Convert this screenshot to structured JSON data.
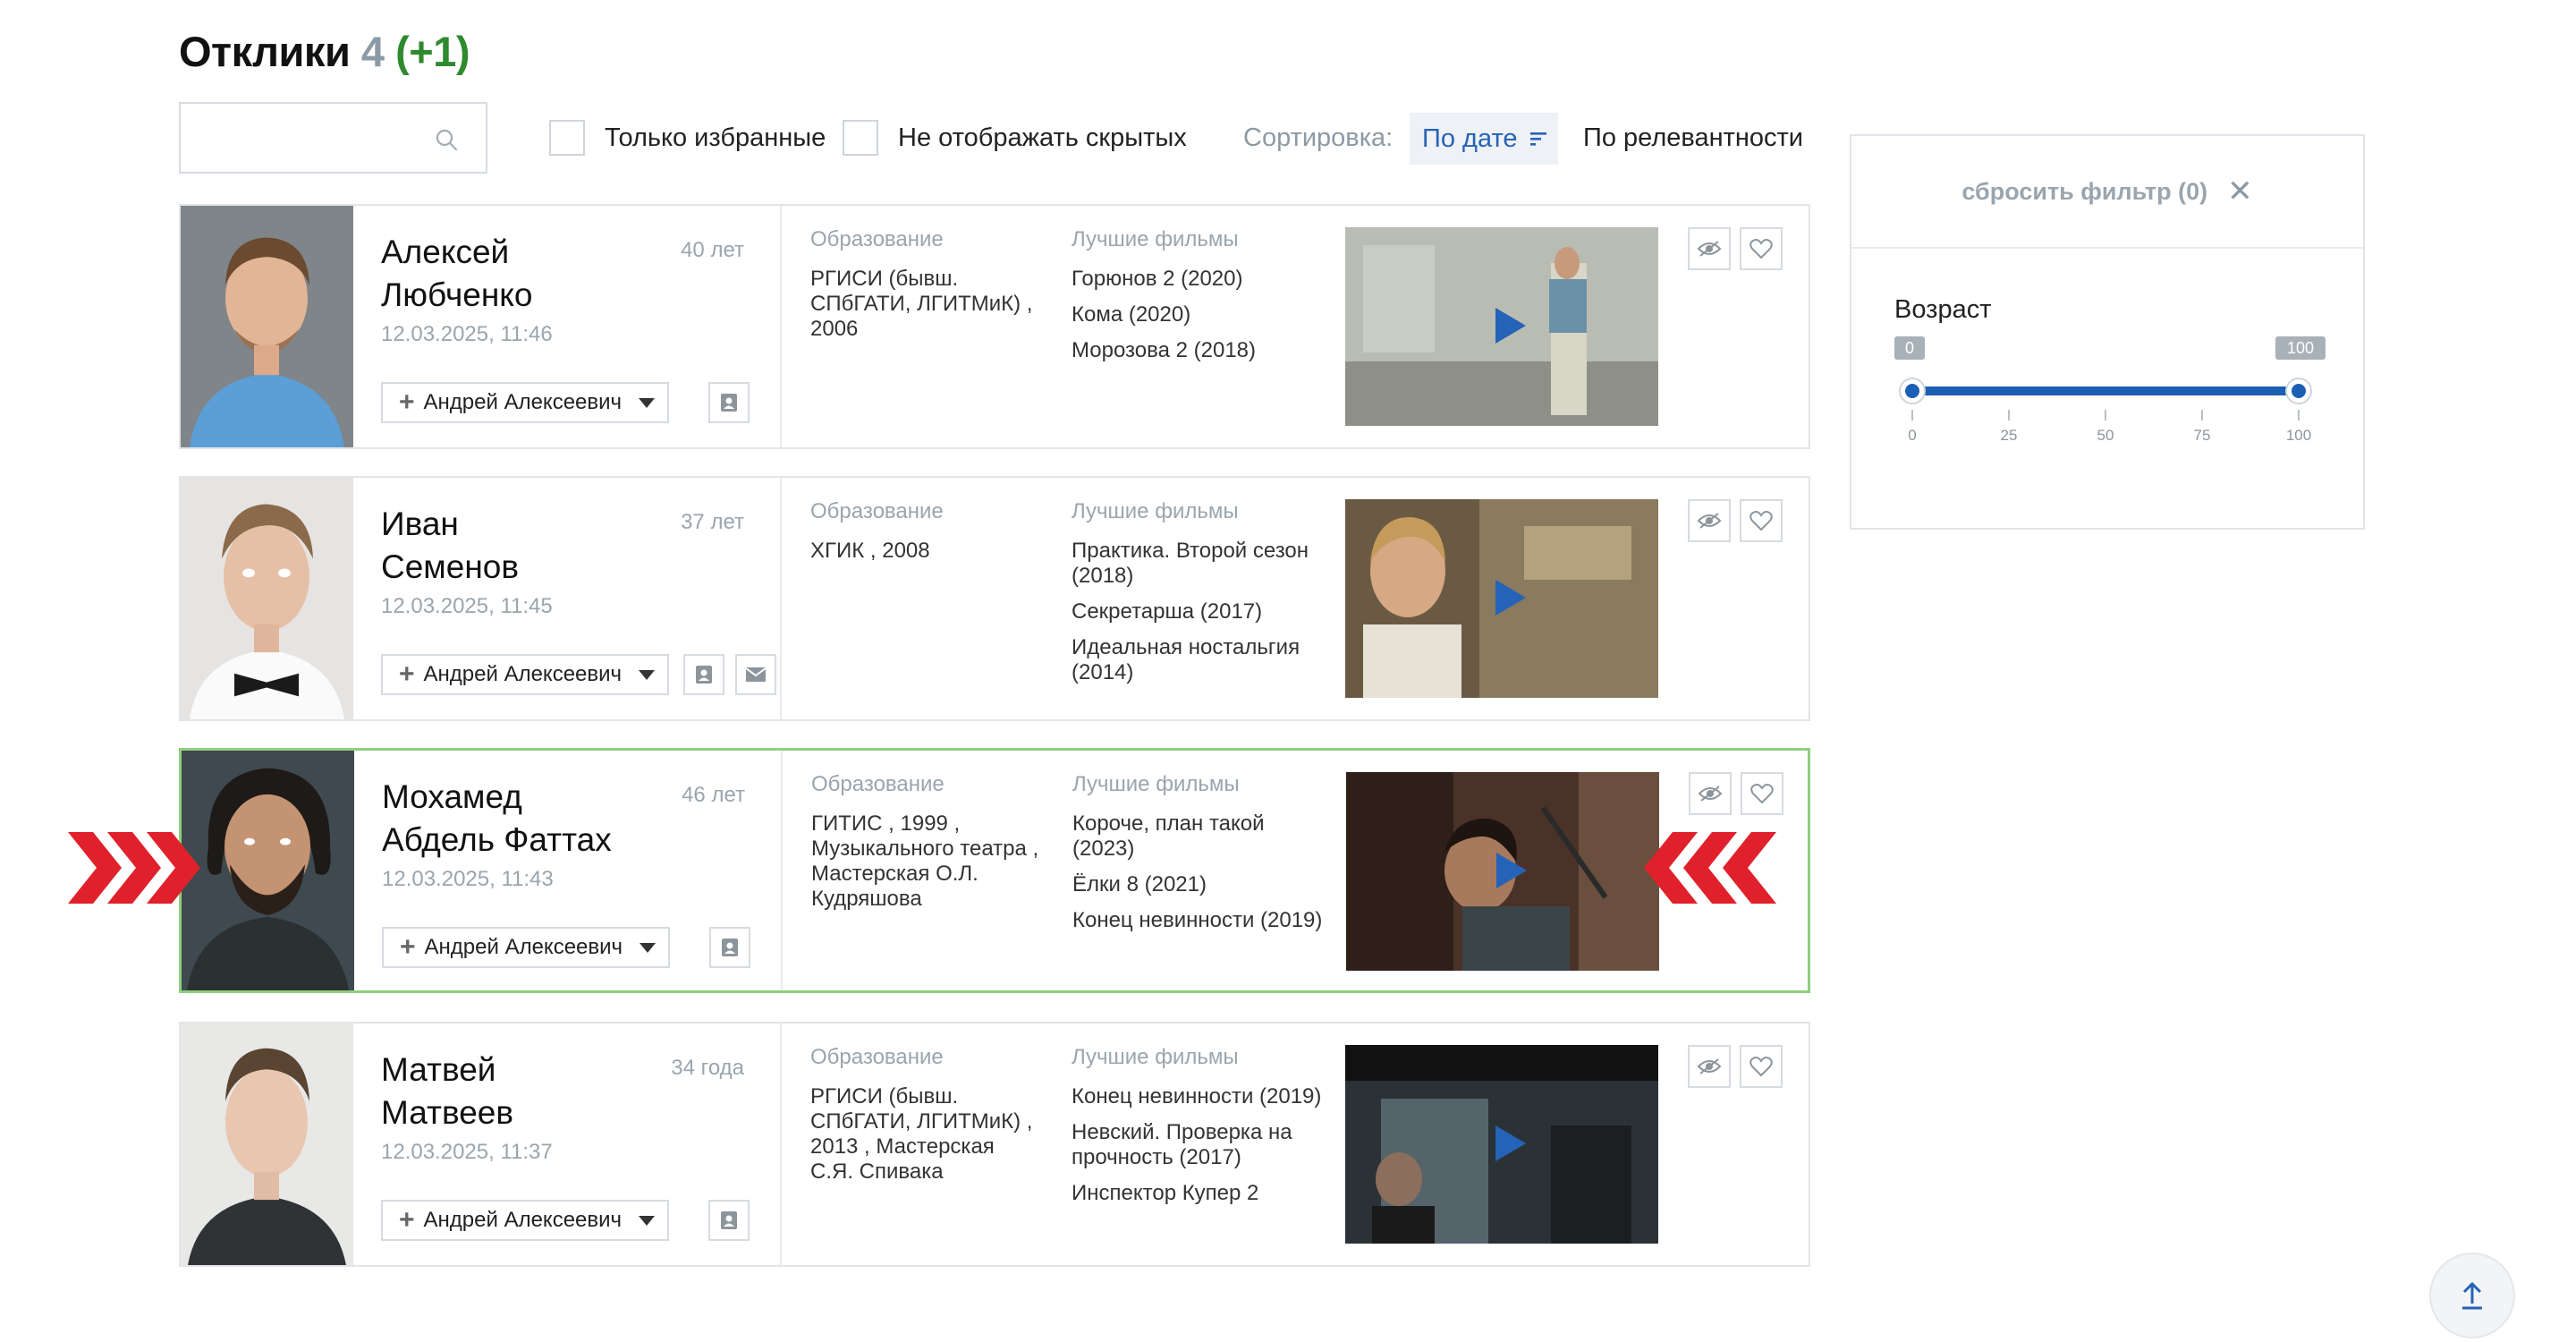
{
  "header": {
    "title": "Отклики",
    "count": "4",
    "new_count": "(+1)"
  },
  "search": {
    "placeholder": "",
    "value": ""
  },
  "filters": {
    "only_favorites": "Только избранные",
    "hide_hidden": "Не отображать скрытых",
    "sort_label": "Сортировка:",
    "sort_by_date": "По дате",
    "sort_by_relevance": "По релевантности"
  },
  "labels": {
    "education": "Образование",
    "best_films": "Лучшие фильмы"
  },
  "candidates": [
    {
      "name_first": "Алексей",
      "name_last": "Любченко",
      "age": "40 лет",
      "date": "12.03.2025, 11:46",
      "assignee": "Андрей Алексеевич",
      "education": "РГИСИ (бывш. СПбГАТИ, ЛГИТМиК) , 2006",
      "films": [
        "Горюнов 2 (2020)",
        "Кома (2020)",
        "Морозова 2 (2018)"
      ]
    },
    {
      "name_first": "Иван",
      "name_last": "Семенов",
      "age": "37 лет",
      "date": "12.03.2025, 11:45",
      "assignee": "Андрей Алексеевич",
      "education": "ХГИК , 2008",
      "films": [
        "Практика. Второй сезон (2018)",
        "Секретарша (2017)",
        "Идеальная ностальгия (2014)"
      ]
    },
    {
      "name_first": "Мохамед",
      "name_last": "Абдель Фаттах",
      "age": "46 лет",
      "date": "12.03.2025, 11:43",
      "assignee": "Андрей Алексеевич",
      "education": "ГИТИС , 1999 , Музыкального театра , Мастерская О.Л. Кудряшова",
      "films": [
        "Короче, план такой (2023)",
        "Ёлки 8 (2021)",
        "Конец невинности (2019)"
      ]
    },
    {
      "name_first": "Матвей",
      "name_last": "Матвеев",
      "age": "34 года",
      "date": "12.03.2025, 11:37",
      "assignee": "Андрей Алексеевич",
      "education": "РГИСИ (бывш. СПбГАТИ, ЛГИТМиК) , 2013 , Мастерская С.Я. Спивака",
      "films": [
        "Конец невинности (2019)",
        "Невский. Проверка на прочность (2017)",
        "Инспектор Купер 2"
      ]
    }
  ],
  "filter_panel": {
    "reset_label": "сбросить фильтр (0)",
    "age_title": "Возраст",
    "age_min": "0",
    "age_max": "100",
    "ticks": [
      "0",
      "25",
      "50",
      "75",
      "100"
    ],
    "range_min_value": 0,
    "range_max_value": 100
  },
  "colors": {
    "accent": "#2563b8",
    "highlight_border": "#8fcf7d",
    "new_count": "#2f8a2f",
    "arrow_red": "#e0212b"
  }
}
